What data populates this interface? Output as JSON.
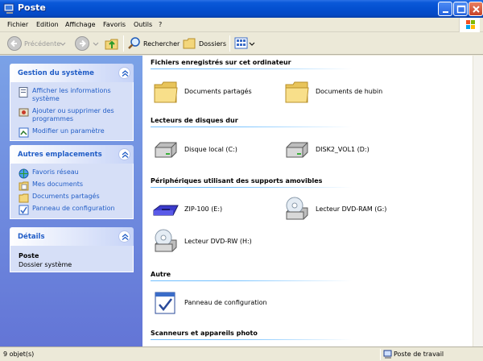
{
  "window": {
    "title": "Poste"
  },
  "menu": [
    "Fichier",
    "Edition",
    "Affichage",
    "Favoris",
    "Outils",
    "?"
  ],
  "toolbar": {
    "back_label": "Précédente",
    "search_label": "Rechercher",
    "folders_label": "Dossiers"
  },
  "tasks": {
    "system": {
      "title": "Gestion du système",
      "items": [
        {
          "label": "Afficher les informations système",
          "icon": "info-icon"
        },
        {
          "label": "Ajouter ou supprimer des programmes",
          "icon": "install-icon"
        },
        {
          "label": "Modifier un paramètre",
          "icon": "settings-icon"
        }
      ]
    },
    "places": {
      "title": "Autres emplacements",
      "items": [
        {
          "label": "Favoris réseau",
          "icon": "network-icon"
        },
        {
          "label": "Mes documents",
          "icon": "documents-icon"
        },
        {
          "label": "Documents partagés",
          "icon": "folder-icon"
        },
        {
          "label": "Panneau de configuration",
          "icon": "control-panel-icon"
        }
      ]
    },
    "details": {
      "title": "Détails",
      "name": "Poste",
      "type": "Dossier système"
    }
  },
  "sections": [
    {
      "title": "Fichiers enregistrés sur cet ordinateur",
      "items": [
        {
          "label": "Documents partagés",
          "icon": "folder-icon"
        },
        {
          "label": "Documents de hubin",
          "icon": "folder-icon"
        }
      ]
    },
    {
      "title": "Lecteurs de disques dur",
      "items": [
        {
          "label": "Disque local (C:)",
          "icon": "hard-drive-icon"
        },
        {
          "label": "DISK2_VOL1 (D:)",
          "icon": "hard-drive-icon"
        }
      ]
    },
    {
      "title": "Périphériques utilisant des supports amovibles",
      "items": [
        {
          "label": "ZIP-100 (E:)",
          "icon": "zip-drive-icon"
        },
        {
          "label": "Lecteur DVD-RAM (G:)",
          "icon": "dvd-drive-icon"
        },
        {
          "label": "Lecteur DVD-RW (H:)",
          "icon": "dvd-drive-icon"
        }
      ]
    },
    {
      "title": "Autre",
      "items": [
        {
          "label": "Panneau de configuration",
          "icon": "control-panel-icon"
        }
      ]
    },
    {
      "title": "Scanneurs et appareils photo",
      "items": []
    }
  ],
  "status": {
    "count": "9 objet(s)",
    "location": "Poste de travail"
  },
  "colors": {
    "titlebar": "#0450D0",
    "task_link": "#215DC6",
    "left_pane": "#7BA2E7"
  }
}
